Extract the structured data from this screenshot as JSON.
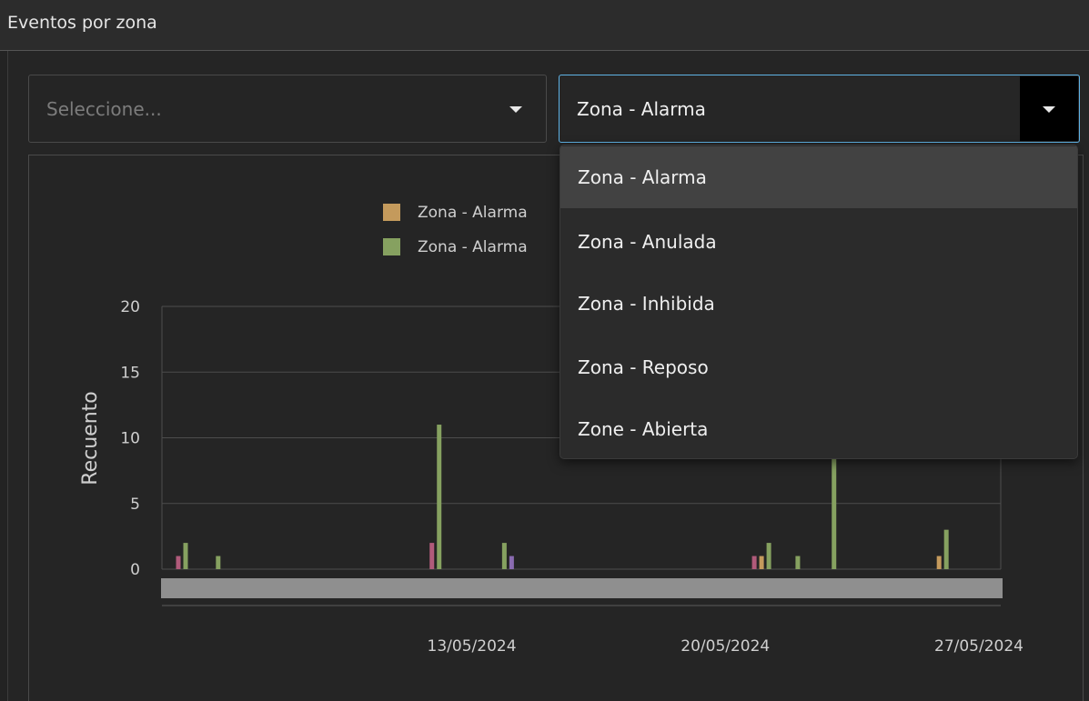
{
  "panel": {
    "title": "Eventos por zona"
  },
  "filters": {
    "left_select": {
      "placeholder": "Seleccione...",
      "icon": "chevron-down-icon"
    },
    "right_select": {
      "value": "Zona - Alarma",
      "icon": "chevron-down-icon"
    }
  },
  "dropdown": {
    "options": [
      {
        "label": "Zona - Alarma",
        "selected": true
      },
      {
        "label": "Zona - Anulada",
        "selected": false
      },
      {
        "label": "Zona - Inhibida",
        "selected": false
      },
      {
        "label": "Zona - Reposo",
        "selected": false
      },
      {
        "label": "Zone - Abierta",
        "selected": false
      }
    ]
  },
  "colors": {
    "accent_border": "#5fb3e6",
    "bar_tan": "#c49a5c",
    "bar_green": "#86a160",
    "bar_pink": "#b05a7a",
    "bar_purple": "#8a6bb0"
  },
  "chart_data": {
    "type": "bar",
    "ylabel": "Recuento",
    "xlabel": "",
    "ylim": [
      0,
      20
    ],
    "yticks": [
      0,
      5,
      10,
      15,
      20
    ],
    "xlim": [
      "2024-05-05",
      "2024-05-27"
    ],
    "xticks": [
      "13/05/2024",
      "20/05/2024",
      "27/05/2024"
    ],
    "grid": true,
    "legend_position": "top",
    "legend_visible_labels": [
      "Zona - Alarma",
      "Zona - Alarma"
    ],
    "series": [
      {
        "color": "#c49a5c",
        "points": [
          {
            "date": "2024-05-21",
            "value": 1
          },
          {
            "date": "2024-05-26",
            "value": 1
          }
        ]
      },
      {
        "color": "#86a160",
        "points": [
          {
            "date": "2024-05-05",
            "value": 2
          },
          {
            "date": "2024-05-06",
            "value": 1
          },
          {
            "date": "2024-05-12",
            "value": 11
          },
          {
            "date": "2024-05-14",
            "value": 2
          },
          {
            "date": "2024-05-21",
            "value": 2
          },
          {
            "date": "2024-05-22",
            "value": 1
          },
          {
            "date": "2024-05-23",
            "value": 9
          },
          {
            "date": "2024-05-26",
            "value": 3
          }
        ]
      },
      {
        "color": "#b05a7a",
        "points": [
          {
            "date": "2024-05-05",
            "value": 1
          },
          {
            "date": "2024-05-12",
            "value": 2
          },
          {
            "date": "2024-05-21",
            "value": 1
          }
        ]
      },
      {
        "color": "#8a6bb0",
        "points": [
          {
            "date": "2024-05-14",
            "value": 1
          }
        ]
      }
    ]
  }
}
